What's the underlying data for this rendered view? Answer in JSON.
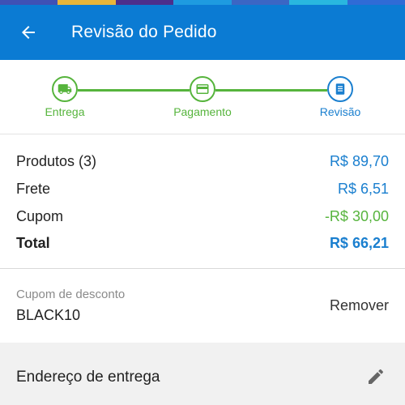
{
  "colors": {
    "app_bar": "#0b7bd3",
    "step_done": "#56b43c",
    "step_current": "#1a7fcf",
    "price": "#1a7fcf",
    "discount": "#57b43e",
    "rainbow": [
      "#3f51b5",
      "#e8b53a",
      "#4c2f8c",
      "#1e9be0",
      "#3b66c4",
      "#29b7df",
      "#2f6bd6"
    ]
  },
  "app_bar": {
    "title": "Revisão do Pedido",
    "back_icon": "arrow-back-icon"
  },
  "stepper": {
    "steps": [
      {
        "label": "Entrega",
        "icon": "truck-icon",
        "state": "done"
      },
      {
        "label": "Pagamento",
        "icon": "credit-card-icon",
        "state": "done"
      },
      {
        "label": "Revisão",
        "icon": "document-icon",
        "state": "current"
      }
    ]
  },
  "summary": {
    "products_label": "Produtos (3)",
    "products_value": "R$ 89,70",
    "shipping_label": "Frete",
    "shipping_value": "R$ 6,51",
    "coupon_label": "Cupom",
    "coupon_value": "-R$ 30,00",
    "total_label": "Total",
    "total_value": "R$ 66,21"
  },
  "coupon": {
    "caption": "Cupom de desconto",
    "code": "BLACK10",
    "remove_label": "Remover"
  },
  "address": {
    "title": "Endereço de entrega",
    "edit_icon": "pencil-icon"
  }
}
